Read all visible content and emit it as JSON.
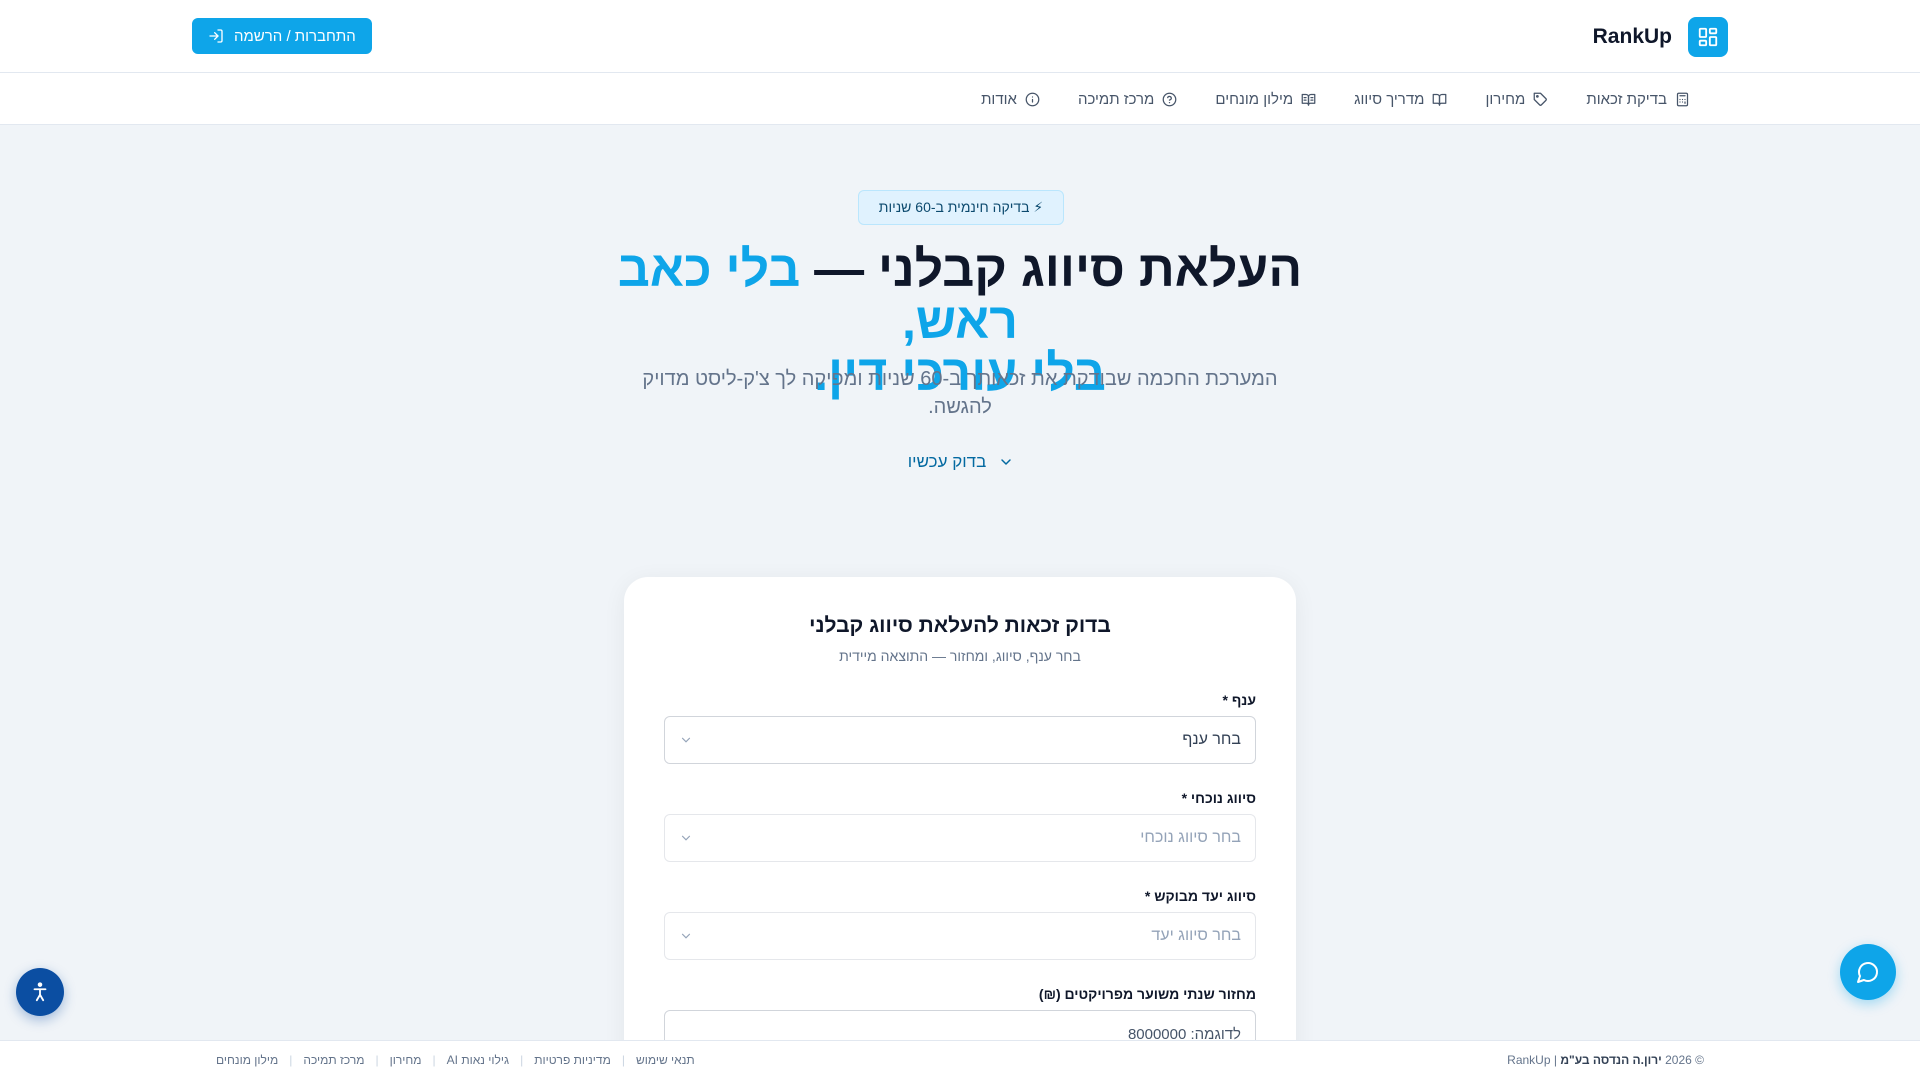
{
  "header": {
    "brand_name": "RankUp",
    "login_label": "התחברות / הרשמה"
  },
  "nav": {
    "items": [
      {
        "label": "בדיקת זכאות",
        "icon": "calculator-icon"
      },
      {
        "label": "מחירון",
        "icon": "tag-icon"
      },
      {
        "label": "מדריך סיווג",
        "icon": "book-icon"
      },
      {
        "label": "מילון מונחים",
        "icon": "book-open-icon"
      },
      {
        "label": "מרכז תמיכה",
        "icon": "help-circle-icon"
      },
      {
        "label": "אודות",
        "icon": "info-icon"
      }
    ]
  },
  "hero": {
    "badge": "⚡ בדיקה חינמית ב-60 שניות",
    "headline_part1": "העלאת סיווג קבלני — ",
    "headline_accent1": "בלי כאב ראש,",
    "headline_accent2": "בלי עורכי דין.",
    "subtitle": "המערכת החכמה שבודקת את זכאותך ב-60 שניות ומפיקה לך צ'ק-ליסט מדויק להגשה.",
    "cta": "בדוק עכשיו"
  },
  "form": {
    "title": "בדוק זכאות להעלאת סיווג קבלני",
    "subtitle": "בחר ענף, סיווג, ומחזור — התוצאה מיידית",
    "fields": {
      "branch": {
        "label": "ענף *",
        "placeholder": "בחר ענף"
      },
      "current": {
        "label": "סיווג נוכחי *",
        "placeholder": "בחר סיווג נוכחי"
      },
      "target": {
        "label": "סיווג יעד מבוקש *",
        "placeholder": "בחר סיווג יעד"
      },
      "turnover": {
        "label": "מחזור שנתי משוער מפרויקטים (₪)",
        "placeholder": "לדוגמה: 8000000"
      }
    }
  },
  "footer": {
    "copyright_prefix": "© 2026",
    "company": "ירון.ה הנדסה בע\"מ",
    "brand_suffix": "| RankUp",
    "links": [
      "תנאי שימוש",
      "מדיניות פרטיות",
      "גילוי נאות AI",
      "מחירון",
      "מרכז תמיכה",
      "מילון מונחים"
    ]
  },
  "colors": {
    "accent": "#0ea5e9",
    "accessibility": "#0b4ea2"
  }
}
